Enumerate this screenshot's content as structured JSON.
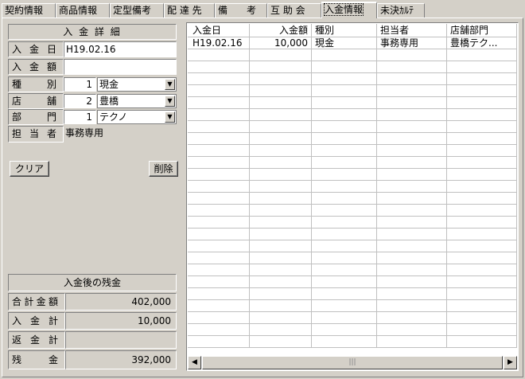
{
  "tabs": [
    {
      "label": "契約情報",
      "active": false
    },
    {
      "label": "商品情報",
      "active": false
    },
    {
      "label": "定型備考",
      "active": false
    },
    {
      "label": "配 達 先",
      "active": false
    },
    {
      "label": "備　　考",
      "active": false
    },
    {
      "label": "互 助 会",
      "active": false
    },
    {
      "label": "入金情報",
      "active": true
    },
    {
      "label": "未決ｶﾙﾃ",
      "active": false
    }
  ],
  "detail": {
    "title": "入 金 詳 細",
    "date_label": "入金日",
    "date_value": "H19.02.16",
    "amount_label": "入金額",
    "amount_value": "",
    "type_label": "種別",
    "type_code": "1",
    "type_value": "現金",
    "store_label": "店舗",
    "store_code": "2",
    "store_value": "豊橋",
    "dept_label": "部門",
    "dept_code": "1",
    "dept_value": "テクノ",
    "staff_label": "担当者",
    "staff_value": "事務専用",
    "clear_button": "クリア",
    "delete_button": "削除"
  },
  "balance": {
    "title": "入金後の残金",
    "rows": [
      {
        "label": "合計金額",
        "value": "402,000"
      },
      {
        "label": "入金計",
        "value": "10,000"
      },
      {
        "label": "返金計",
        "value": ""
      },
      {
        "label": "残　金",
        "value": "392,000"
      }
    ]
  },
  "grid": {
    "columns": [
      "入金日",
      "入金額",
      "種別",
      "担当者",
      "店舗部門"
    ],
    "rows": [
      [
        "H19.02.16",
        "10,000",
        "現金",
        "事務専用",
        "豊橋テク..."
      ]
    ],
    "scroll_left_icon": "arrow-left-icon",
    "scroll_right_icon": "arrow-right-icon"
  }
}
